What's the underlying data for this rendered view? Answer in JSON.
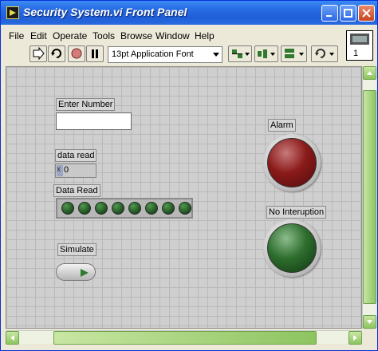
{
  "window": {
    "title": "Security System.vi Front Panel"
  },
  "menu": [
    "File",
    "Edit",
    "Operate",
    "Tools",
    "Browse",
    "Window",
    "Help"
  ],
  "toolbar": {
    "font": "13pt Application Font"
  },
  "vi_icon": {
    "label": "1"
  },
  "controls": {
    "enter_number": {
      "label": "Enter Number",
      "value": ""
    },
    "data_read_numeric": {
      "label": "data read",
      "radix": "x",
      "value": "0"
    },
    "data_read_array": {
      "label": "Data Read",
      "led_count": 8
    },
    "simulate": {
      "label": "Simulate"
    },
    "alarm": {
      "label": "Alarm",
      "color": "#8b1a1a"
    },
    "no_interuption": {
      "label": "No Interuption",
      "color": "#2e6e2e"
    }
  },
  "colors": {
    "titlebar": "#2a6fe6",
    "panel": "#cfcfcf",
    "led_on": "#2e6e2e"
  }
}
